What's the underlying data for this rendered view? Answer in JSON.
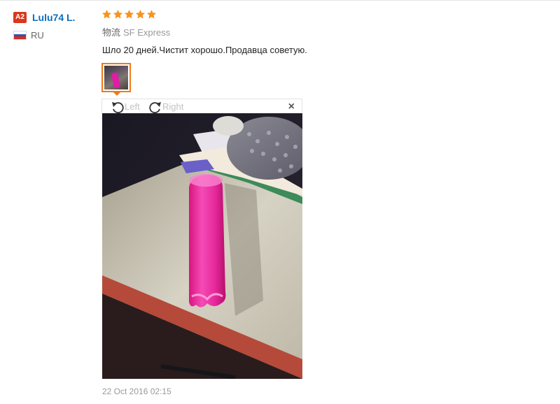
{
  "reviewer": {
    "level_badge": "A2",
    "name": "Lulu74 L.",
    "country_code": "RU",
    "flag_colors": [
      "#ffffff",
      "#2a56b0",
      "#d52b1e"
    ]
  },
  "review": {
    "rating": 5,
    "max_rating": 5,
    "star_color": "#f7931e",
    "logistics_label": "物流",
    "logistics_value": "SF Express",
    "text": "Шло 20 дней.Чистит хорошо.Продавца советую.",
    "date": "22 Oct 2016 02:15"
  },
  "image_viewer": {
    "rotate_left_label": "Left",
    "rotate_right_label": "Right",
    "rotate_left_icon": "rotate-left-icon",
    "rotate_right_icon": "rotate-right-icon",
    "close_glyph": "×",
    "close_icon": "close-icon",
    "thumbnail_accent": "#f07a16"
  }
}
